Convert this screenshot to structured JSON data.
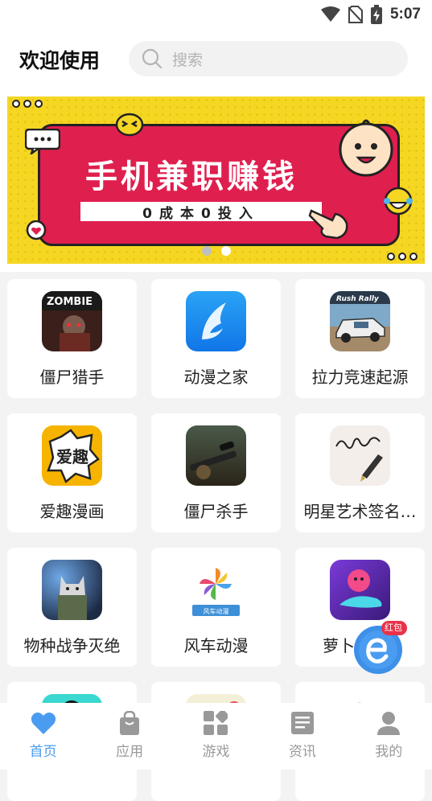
{
  "status_bar": {
    "time": "5:07",
    "icons": [
      "wifi-icon",
      "no-sim-icon",
      "battery-charging-icon"
    ]
  },
  "header": {
    "title": "欢迎使用",
    "search_placeholder": "搜索"
  },
  "banner": {
    "headline": "手机兼职赚钱",
    "subline": "0成本0投入",
    "page_count": 2,
    "active_page": 2
  },
  "apps": [
    {
      "label": "僵尸猎手",
      "icon": "zombie-hunter-icon"
    },
    {
      "label": "动漫之家",
      "icon": "feather-icon"
    },
    {
      "label": "拉力竞速起源",
      "icon": "rally-car-icon"
    },
    {
      "label": "爱趣漫画",
      "icon": "aiqu-comic-icon"
    },
    {
      "label": "僵尸杀手",
      "icon": "sniper-icon"
    },
    {
      "label": "明星艺术签名…",
      "icon": "signature-pen-icon"
    },
    {
      "label": "物种战争灭绝",
      "icon": "soldier-cat-icon"
    },
    {
      "label": "风车动漫",
      "icon": "pinwheel-icon"
    },
    {
      "label": "萝卜",
      "icon": "dolphin-icon"
    }
  ],
  "floating_button": {
    "badge": "红包"
  },
  "tabs": [
    {
      "label": "首页",
      "icon": "heart-icon",
      "active": true
    },
    {
      "label": "应用",
      "icon": "bag-icon",
      "active": false
    },
    {
      "label": "游戏",
      "icon": "grid-icon",
      "active": false
    },
    {
      "label": "资讯",
      "icon": "news-icon",
      "active": false
    },
    {
      "label": "我的",
      "icon": "user-icon",
      "active": false
    }
  ],
  "colors": {
    "accent": "#4a9cf0",
    "banner_yellow": "#f5d623",
    "banner_red": "#df1f4e"
  }
}
